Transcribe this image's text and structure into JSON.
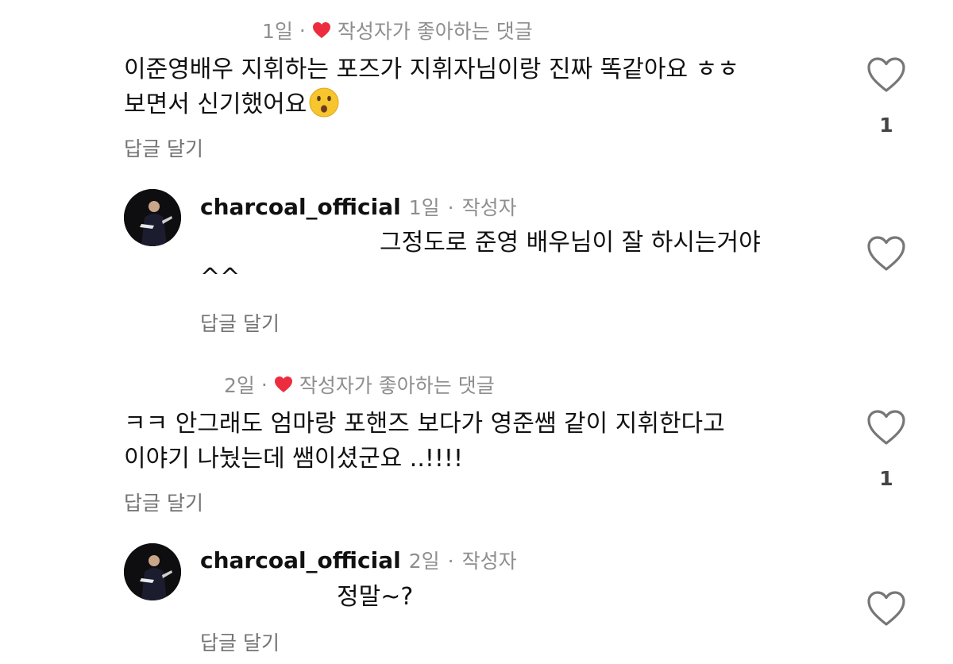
{
  "colors": {
    "heart_red": "#ed2c3e",
    "meta_gray": "#8e8e8e",
    "text": "#111111"
  },
  "comments": [
    {
      "meta_time": "1일",
      "meta_sep": "·",
      "meta_label": "작성자가 좋아하는 댓글",
      "line1": "이준영배우 지휘하는 포즈가 지휘자님이랑 진짜 똑같아요 ㅎㅎ",
      "line2": "보면서 신기했어요",
      "emoji": "hushed-face-icon",
      "reply_label": "답글 달기",
      "like_count": "1",
      "reply": {
        "username": "charcoal_official",
        "time": "1일",
        "sep": "·",
        "badge": "작성자",
        "line1": "그정도로 준영 배우님이 잘 하시는거야",
        "line2": "^^",
        "reply_label": "답글 달기"
      }
    },
    {
      "meta_time": "2일",
      "meta_sep": "·",
      "meta_label": "작성자가 좋아하는 댓글",
      "line1": "ㅋㅋ 안그래도 엄마랑 포핸즈 보다가  영준쌤 같이 지휘한다고",
      "line2": "이야기 나눴는데 쌤이셨군요 ..!!!!",
      "reply_label": "답글 달기",
      "like_count": "1",
      "reply": {
        "username": "charcoal_official",
        "time": "2일",
        "sep": "·",
        "badge": "작성자",
        "line1": "정말~?",
        "reply_label": "답글 달기"
      }
    }
  ]
}
